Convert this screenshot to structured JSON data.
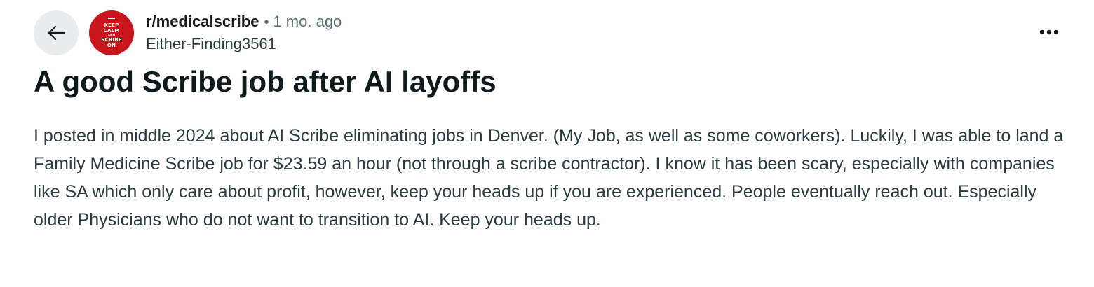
{
  "header": {
    "subreddit": "r/medicalscribe",
    "separator": "•",
    "timestamp": "1 mo. ago",
    "author": "Either-Finding3561",
    "avatar_lines": [
      "KEEP",
      "CALM",
      "AND",
      "SCRIBE",
      "ON"
    ],
    "icons": {
      "back": "arrow-left-icon",
      "more": "more-horizontal-icon"
    },
    "colors": {
      "avatar_background": "#c8141a",
      "back_button_background": "#e9ebed"
    }
  },
  "post": {
    "title": "A good Scribe job after AI layoffs",
    "body": "I posted in middle 2024 about AI Scribe eliminating jobs in Denver. (My Job, as well as some coworkers). Luckily, I was able to land a Family Medicine Scribe job for $23.59 an hour (not through a scribe contractor). I know it has been scary, especially with companies like SA which only care about profit, however, keep your heads up if you are experienced. People eventually reach out. Especially older Physicians who do not want to transition to AI. Keep your heads up."
  }
}
